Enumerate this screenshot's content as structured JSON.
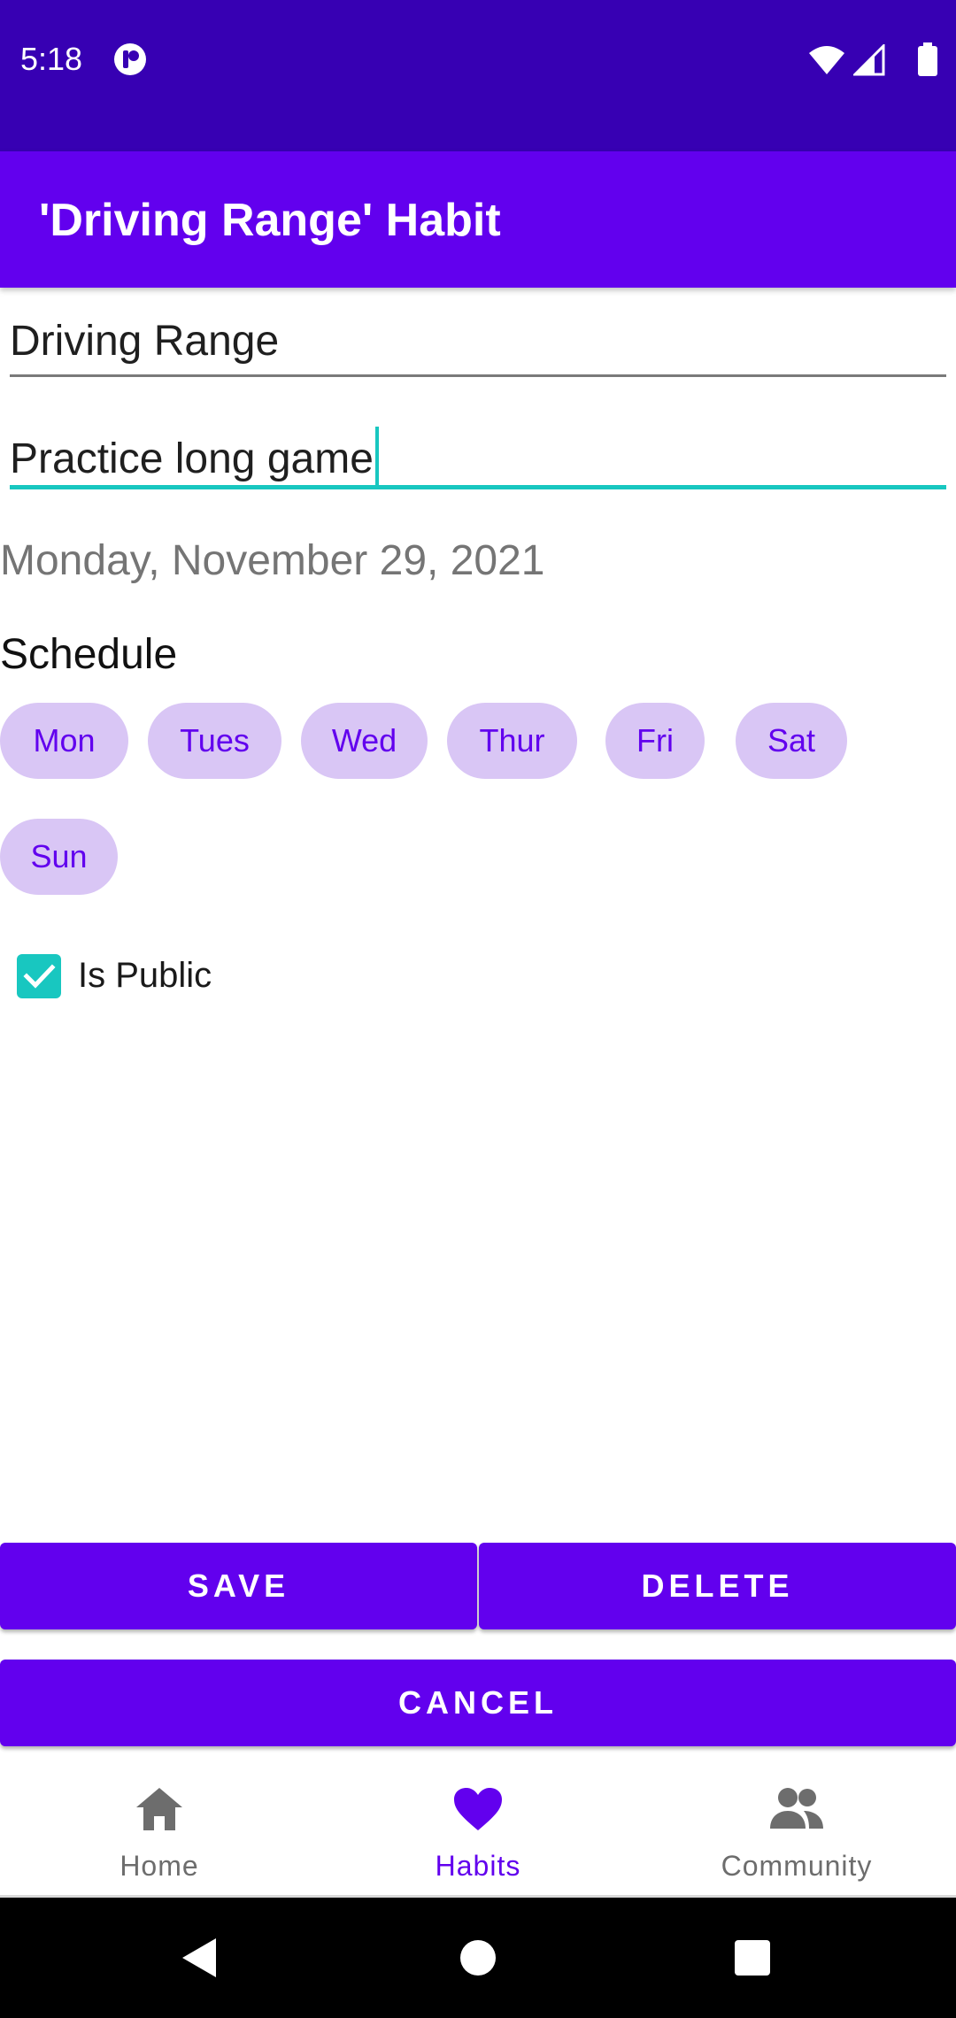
{
  "status_bar": {
    "time": "5:18",
    "icons": [
      "app-notification-icon",
      "wifi-icon",
      "signal-icon",
      "battery-icon"
    ]
  },
  "app_bar": {
    "title": "'Driving Range' Habit"
  },
  "form": {
    "name_value": "Driving Range",
    "description_value": "Practice long game",
    "date": "Monday, November 29, 2021",
    "schedule_label": "Schedule",
    "days": [
      "Mon",
      "Tues",
      "Wed",
      "Thur",
      "Fri",
      "Sat",
      "Sun"
    ],
    "is_public_label": "Is Public",
    "is_public_checked": true
  },
  "actions": {
    "save": "SAVE",
    "delete": "DELETE",
    "cancel": "CANCEL"
  },
  "bottom_nav": {
    "items": [
      {
        "label": "Home",
        "icon": "home-icon",
        "active": false
      },
      {
        "label": "Habits",
        "icon": "heart-icon",
        "active": true
      },
      {
        "label": "Community",
        "icon": "people-icon",
        "active": false
      }
    ]
  },
  "colors": {
    "status_bar": "#3700b3",
    "primary": "#6200ee",
    "accent": "#18c7c0",
    "chip_bg": "#d9c6f5"
  }
}
